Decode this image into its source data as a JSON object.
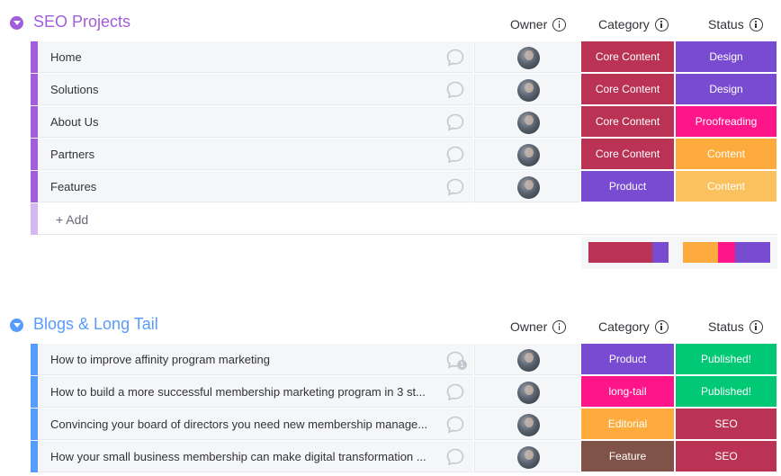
{
  "columns": {
    "owner": "Owner",
    "category": "Category",
    "status": "Status"
  },
  "colors": {
    "core_content": "#bb3354",
    "product": "#784bd1",
    "design": "#784bd1",
    "proofreading": "#ff158a",
    "content": "#fdab3d",
    "content_light": "#fcc15f",
    "long_tail": "#ff158a",
    "editorial": "#fdab3d",
    "feature": "#7f5347",
    "published": "#00c875",
    "seo": "#bb3354",
    "group1_accent": "#a25ddc",
    "group2_accent": "#579bfc"
  },
  "groups": [
    {
      "title": "SEO Projects",
      "accent": "#a25ddc",
      "rows": [
        {
          "name": "Home",
          "category": "Core Content",
          "category_color": "#bb3354",
          "status": "Design",
          "status_color": "#784bd1",
          "comments": ""
        },
        {
          "name": "Solutions",
          "category": "Core Content",
          "category_color": "#bb3354",
          "status": "Design",
          "status_color": "#784bd1",
          "comments": ""
        },
        {
          "name": "About Us",
          "category": "Core Content",
          "category_color": "#bb3354",
          "status": "Proofreading",
          "status_color": "#ff158a",
          "comments": ""
        },
        {
          "name": "Partners",
          "category": "Core Content",
          "category_color": "#bb3354",
          "status": "Content",
          "status_color": "#fdab3d",
          "comments": ""
        },
        {
          "name": "Features",
          "category": "Product",
          "category_color": "#784bd1",
          "status": "Content",
          "status_color": "#fcc15f",
          "comments": ""
        }
      ],
      "add_label": "+ Add",
      "category_summary": [
        {
          "color": "#bb3354",
          "share": 0.8
        },
        {
          "color": "#784bd1",
          "share": 0.2
        }
      ],
      "status_summary": [
        {
          "color": "#fdab3d",
          "share": 0.4
        },
        {
          "color": "#ff158a",
          "share": 0.2
        },
        {
          "color": "#784bd1",
          "share": 0.4
        }
      ]
    },
    {
      "title": "Blogs & Long Tail",
      "accent": "#579bfc",
      "rows": [
        {
          "name": "How to improve affinity program marketing",
          "category": "Product",
          "category_color": "#784bd1",
          "status": "Published!",
          "status_color": "#00c875",
          "comments": "1"
        },
        {
          "name": "How to build a more successful membership marketing program in 3 st...",
          "category": "long-tail",
          "category_color": "#ff158a",
          "status": "Published!",
          "status_color": "#00c875",
          "comments": ""
        },
        {
          "name": "Convincing your board of directors you need new membership manage...",
          "category": "Editorial",
          "category_color": "#fdab3d",
          "status": "SEO",
          "status_color": "#bb3354",
          "comments": ""
        },
        {
          "name": "How your small business membership can make digital transformation ...",
          "category": "Feature",
          "category_color": "#7f5347",
          "status": "SEO",
          "status_color": "#bb3354",
          "comments": ""
        }
      ]
    }
  ]
}
